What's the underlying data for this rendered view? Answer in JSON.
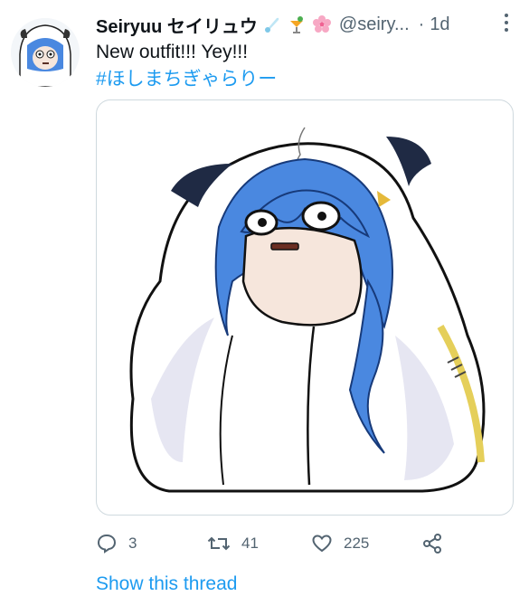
{
  "tweet": {
    "display_name": "Seiryuu セイリュウ",
    "handle": "@seiry...",
    "separator": "·",
    "timestamp": "1d",
    "text": "New outfit!!! Yey!!!",
    "hashtag": "#ほしまちぎゃらりー",
    "name_emojis": [
      "comet-icon",
      "cocktail-icon",
      "cherry-blossom-icon"
    ]
  },
  "actions": {
    "reply_count": "3",
    "retweet_count": "41",
    "like_count": "225"
  },
  "show_thread_label": "Show this thread",
  "colors": {
    "link_blue": "#1d9bf0",
    "muted_gray": "#536471",
    "hair_blue": "#4a88e0",
    "cloak_white": "#ffffff",
    "cloak_shadow": "#e6e6f2"
  }
}
